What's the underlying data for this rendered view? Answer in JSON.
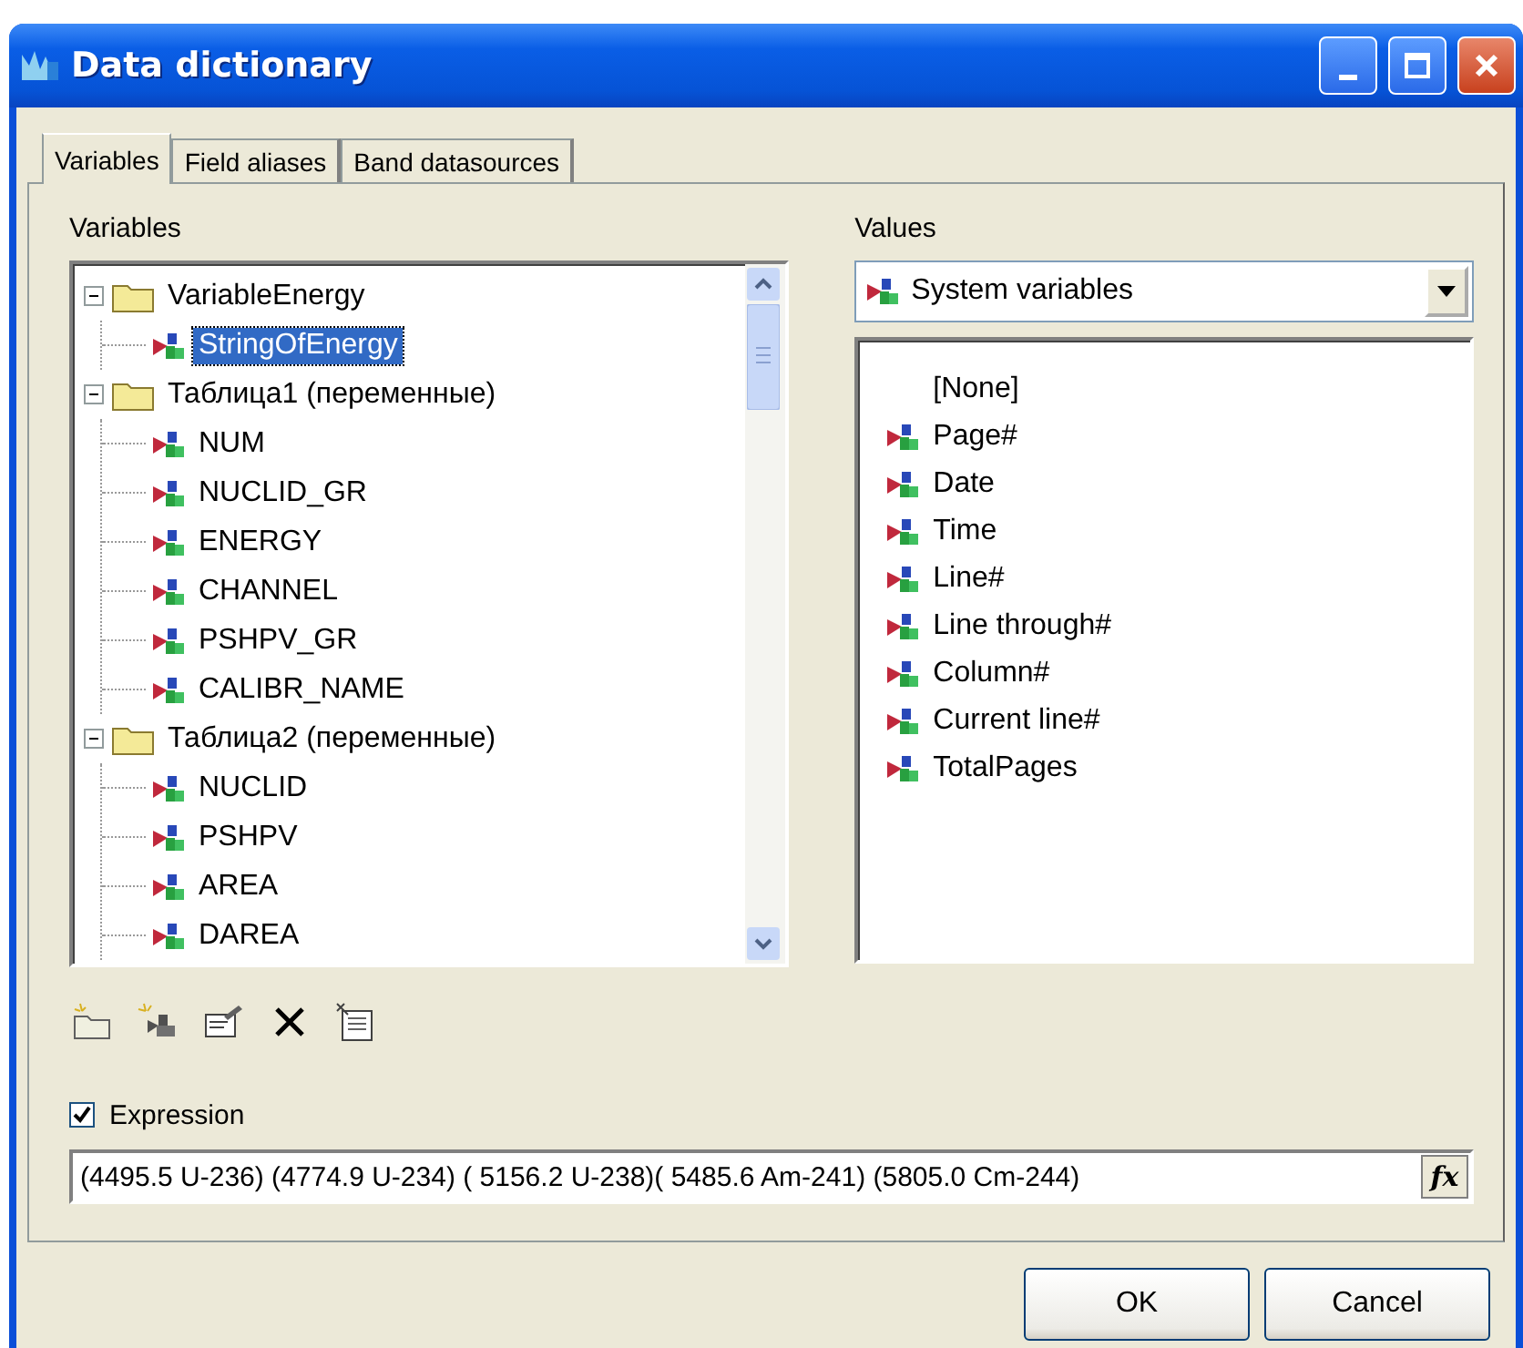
{
  "window": {
    "title": "Data dictionary"
  },
  "tabs": [
    {
      "label": "Variables",
      "selected": true
    },
    {
      "label": "Field aliases",
      "selected": false
    },
    {
      "label": "Band datasources",
      "selected": false
    }
  ],
  "variables": {
    "label": "Variables",
    "tree": [
      {
        "label": "VariableEnergy",
        "kind": "folder",
        "expanded": true,
        "selected": false,
        "children": [
          {
            "label": "StringOfEnergy",
            "kind": "variable",
            "selected": true
          }
        ]
      },
      {
        "label": "Таблица1 (переменные)",
        "kind": "folder",
        "expanded": true,
        "selected": false,
        "children": [
          {
            "label": "NUM",
            "kind": "variable",
            "selected": false
          },
          {
            "label": "NUCLID_GR",
            "kind": "variable",
            "selected": false
          },
          {
            "label": "ENERGY",
            "kind": "variable",
            "selected": false
          },
          {
            "label": "CHANNEL",
            "kind": "variable",
            "selected": false
          },
          {
            "label": "PSHPV_GR",
            "kind": "variable",
            "selected": false
          },
          {
            "label": "CALIBR_NAME",
            "kind": "variable",
            "selected": false
          }
        ]
      },
      {
        "label": "Таблица2 (переменные)",
        "kind": "folder",
        "expanded": true,
        "selected": false,
        "children": [
          {
            "label": "NUCLID",
            "kind": "variable",
            "selected": false
          },
          {
            "label": "PSHPV",
            "kind": "variable",
            "selected": false
          },
          {
            "label": "AREA",
            "kind": "variable",
            "selected": false
          },
          {
            "label": "DAREA",
            "kind": "variable",
            "selected": false
          }
        ]
      }
    ]
  },
  "values": {
    "label": "Values",
    "dropdown": "System variables",
    "items": [
      {
        "label": "[None]",
        "kind": "none",
        "selected": false
      },
      {
        "label": "Page#",
        "kind": "variable",
        "selected": false
      },
      {
        "label": "Date",
        "kind": "variable",
        "selected": false
      },
      {
        "label": "Time",
        "kind": "variable",
        "selected": false
      },
      {
        "label": "Line#",
        "kind": "variable",
        "selected": false
      },
      {
        "label": "Line through#",
        "kind": "variable",
        "selected": false
      },
      {
        "label": "Column#",
        "kind": "variable",
        "selected": false
      },
      {
        "label": "Current line#",
        "kind": "variable",
        "selected": false
      },
      {
        "label": "TotalPages",
        "kind": "variable",
        "selected": false
      }
    ]
  },
  "expression": {
    "label": "Expression",
    "checked": true,
    "function_button": "fx",
    "value": "(4495.5 U-236) (4774.9 U-234) ( 5156.2 U-238)( 5485.6 Am-241) (5805.0 Cm-244)"
  },
  "buttons": [
    "OK",
    "Cancel"
  ]
}
